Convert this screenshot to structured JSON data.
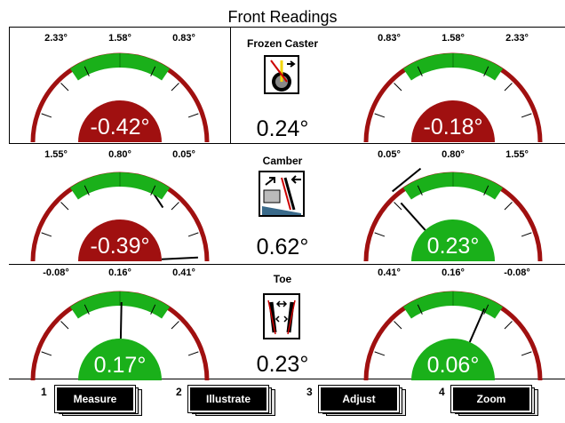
{
  "title": "Front Readings",
  "rows": [
    {
      "label": "Frozen Caster",
      "center_value": "0.24°",
      "icon": "caster-icon",
      "left": {
        "ticks": [
          "2.33°",
          "1.58°",
          "0.83°"
        ],
        "reading": "-0.42°",
        "needle": -0.42,
        "status": "out-of-spec"
      },
      "right": {
        "ticks": [
          "0.83°",
          "1.58°",
          "2.33°"
        ],
        "reading": "-0.18°",
        "needle": -0.18,
        "status": "out-of-spec"
      }
    },
    {
      "label": "Camber",
      "center_value": "0.62°",
      "icon": "camber-icon",
      "left": {
        "ticks": [
          "1.55°",
          "0.80°",
          "0.05°"
        ],
        "reading": "-0.39°",
        "needle": -0.39,
        "status": "out-of-spec"
      },
      "right": {
        "ticks": [
          "0.05°",
          "0.80°",
          "1.55°"
        ],
        "reading": "0.23°",
        "needle": 0.23,
        "status": "in-spec"
      }
    },
    {
      "label": "Toe",
      "center_value": "0.23°",
      "icon": "toe-icon",
      "left": {
        "ticks": [
          "-0.08°",
          "0.16°",
          "0.41°"
        ],
        "reading": "0.17°",
        "needle": 0.17,
        "status": "in-spec"
      },
      "right": {
        "ticks": [
          "0.41°",
          "0.16°",
          "-0.08°"
        ],
        "reading": "0.06°",
        "needle": 0.06,
        "status": "in-spec"
      }
    }
  ],
  "buttons": [
    {
      "key": "1",
      "label": "Measure"
    },
    {
      "key": "2",
      "label": "Illustrate"
    },
    {
      "key": "3",
      "label": "Adjust"
    },
    {
      "key": "4",
      "label": "Zoom"
    }
  ],
  "colors": {
    "out_of_spec": "#a01010",
    "in_spec": "#1ab01a",
    "arc": "#a01010",
    "spec_band": "#1ab01a"
  }
}
